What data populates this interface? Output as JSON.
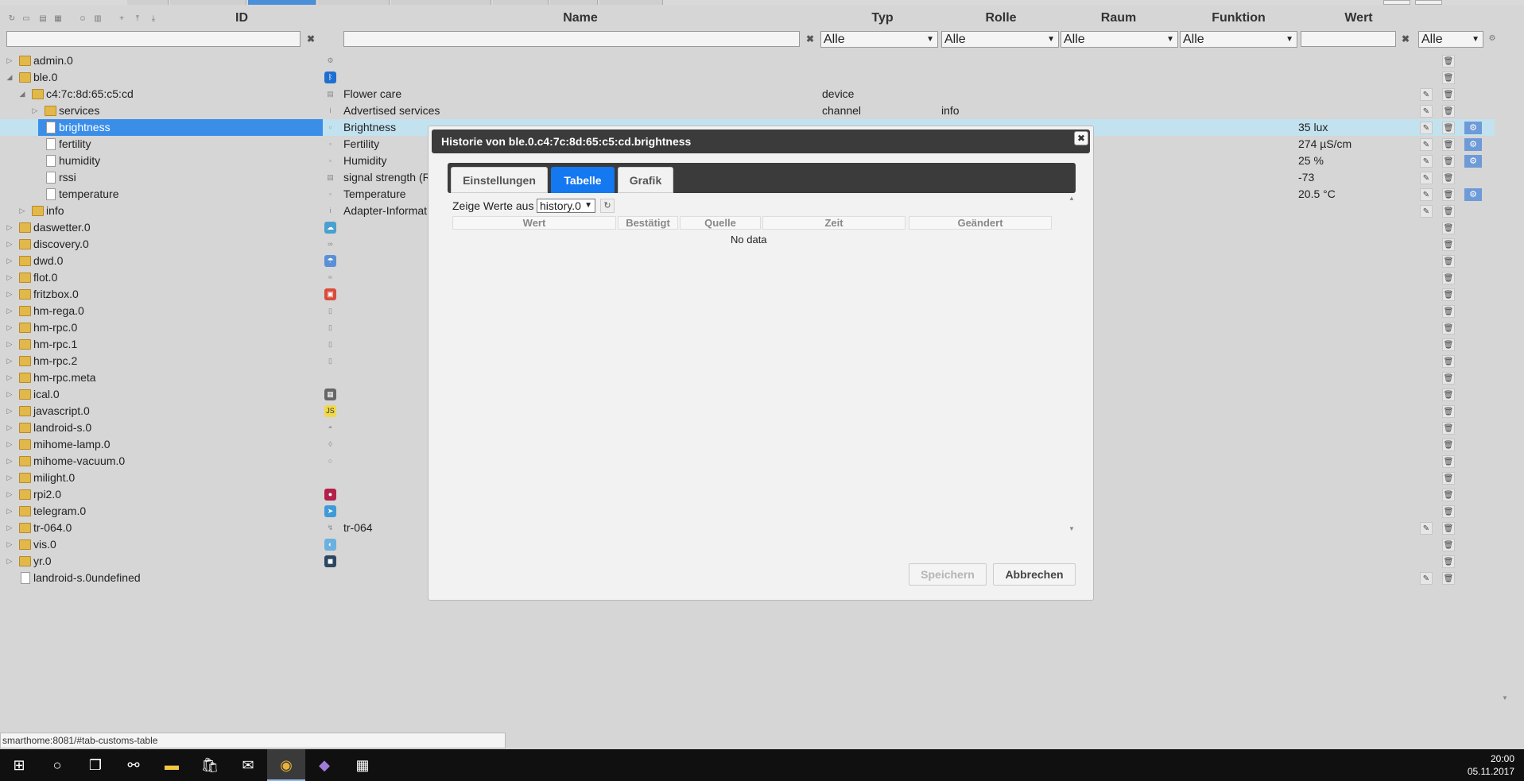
{
  "header": {
    "columns": {
      "id": "ID",
      "name": "Name",
      "typ": "Typ",
      "rolle": "Rolle",
      "raum": "Raum",
      "funktion": "Funktion",
      "wert": "Wert"
    },
    "filters": {
      "typ": "Alle",
      "rolle": "Alle",
      "raum": "Alle",
      "funktion": "Alle",
      "extra": "Alle"
    },
    "clear_glyph": "✖",
    "toolbar_icons": [
      "refresh-icon",
      "collapse-icon",
      "folder-icon",
      "folder-open-icon",
      "user-icon",
      "list-icon",
      "add-icon",
      "upload-icon",
      "download-icon"
    ]
  },
  "tree": {
    "rows": [
      {
        "id": "admin.0",
        "name": "",
        "typ": "",
        "rolle": "",
        "wert": "",
        "icon": "gear-icon",
        "kind": "folder",
        "level": 0
      },
      {
        "id": "ble.0",
        "name": "",
        "typ": "",
        "rolle": "",
        "wert": "",
        "icon": "bluetooth-icon",
        "kind": "folder",
        "level": 0,
        "expanded": true
      },
      {
        "id": "c4:7c:8d:65:c5:cd",
        "name": "Flower care",
        "typ": "device",
        "rolle": "",
        "wert": "",
        "icon": "device-icon",
        "kind": "folder",
        "level": 1,
        "expanded": true
      },
      {
        "id": "services",
        "name": "Advertised services",
        "typ": "channel",
        "rolle": "info",
        "wert": "",
        "icon": "info-icon",
        "kind": "folder",
        "level": 2
      },
      {
        "id": "brightness",
        "name": "Brightness",
        "typ": "",
        "rolle": "",
        "wert": "35 lux",
        "icon": "state-icon",
        "kind": "file",
        "level": 2,
        "selected": true
      },
      {
        "id": "fertility",
        "name": "Fertility",
        "typ": "",
        "rolle": "",
        "wert": "274 µS/cm",
        "icon": "state-icon",
        "kind": "file",
        "level": 2
      },
      {
        "id": "humidity",
        "name": "Humidity",
        "typ": "",
        "rolle": "",
        "wert": "25 %",
        "icon": "state-icon",
        "kind": "file",
        "level": 2
      },
      {
        "id": "rssi",
        "name": "signal strength (R",
        "typ": "",
        "rolle": "",
        "wert": "-73",
        "icon": "signal-icon",
        "kind": "file",
        "level": 2
      },
      {
        "id": "temperature",
        "name": "Temperature",
        "typ": "",
        "rolle": "",
        "wert": "20.5 °C",
        "icon": "state-icon",
        "kind": "file",
        "level": 2
      },
      {
        "id": "info",
        "name": "Adapter-Informat",
        "typ": "",
        "rolle": "",
        "wert": "",
        "icon": "info-icon",
        "kind": "folder",
        "level": 1
      },
      {
        "id": "daswetter.0",
        "name": "",
        "typ": "",
        "rolle": "",
        "wert": "",
        "icon": "weather-icon",
        "kind": "folder",
        "level": 0
      },
      {
        "id": "discovery.0",
        "name": "",
        "typ": "",
        "rolle": "",
        "wert": "",
        "icon": "binoculars-icon",
        "kind": "folder",
        "level": 0
      },
      {
        "id": "dwd.0",
        "name": "",
        "typ": "",
        "rolle": "",
        "wert": "",
        "icon": "dwd-icon",
        "kind": "folder",
        "level": 0
      },
      {
        "id": "flot.0",
        "name": "",
        "typ": "",
        "rolle": "",
        "wert": "",
        "icon": "flot-icon",
        "kind": "folder",
        "level": 0
      },
      {
        "id": "fritzbox.0",
        "name": "",
        "typ": "",
        "rolle": "",
        "wert": "",
        "icon": "fritzbox-icon",
        "kind": "folder",
        "level": 0
      },
      {
        "id": "hm-rega.0",
        "name": "",
        "typ": "",
        "rolle": "",
        "wert": "",
        "icon": "homematic-icon",
        "kind": "folder",
        "level": 0
      },
      {
        "id": "hm-rpc.0",
        "name": "",
        "typ": "",
        "rolle": "",
        "wert": "",
        "icon": "homematic-icon",
        "kind": "folder",
        "level": 0
      },
      {
        "id": "hm-rpc.1",
        "name": "",
        "typ": "",
        "rolle": "",
        "wert": "",
        "icon": "homematic-icon",
        "kind": "folder",
        "level": 0
      },
      {
        "id": "hm-rpc.2",
        "name": "",
        "typ": "",
        "rolle": "",
        "wert": "",
        "icon": "homematic-icon",
        "kind": "folder",
        "level": 0
      },
      {
        "id": "hm-rpc.meta",
        "name": "",
        "typ": "",
        "rolle": "",
        "wert": "",
        "icon": "",
        "kind": "folder",
        "level": 0
      },
      {
        "id": "ical.0",
        "name": "",
        "typ": "",
        "rolle": "",
        "wert": "",
        "icon": "calendar-icon",
        "kind": "folder",
        "level": 0
      },
      {
        "id": "javascript.0",
        "name": "",
        "typ": "",
        "rolle": "",
        "wert": "",
        "icon": "javascript-icon",
        "kind": "folder",
        "level": 0
      },
      {
        "id": "landroid-s.0",
        "name": "",
        "typ": "",
        "rolle": "",
        "wert": "",
        "icon": "mower-icon",
        "kind": "folder",
        "level": 0
      },
      {
        "id": "mihome-lamp.0",
        "name": "",
        "typ": "",
        "rolle": "",
        "wert": "",
        "icon": "lamp-icon",
        "kind": "folder",
        "level": 0
      },
      {
        "id": "mihome-vacuum.0",
        "name": "",
        "typ": "",
        "rolle": "",
        "wert": "",
        "icon": "vacuum-icon",
        "kind": "folder",
        "level": 0
      },
      {
        "id": "milight.0",
        "name": "",
        "typ": "",
        "rolle": "",
        "wert": "",
        "icon": "",
        "kind": "folder",
        "level": 0
      },
      {
        "id": "rpi2.0",
        "name": "",
        "typ": "",
        "rolle": "",
        "wert": "",
        "icon": "raspberry-icon",
        "kind": "folder",
        "level": 0
      },
      {
        "id": "telegram.0",
        "name": "",
        "typ": "",
        "rolle": "",
        "wert": "",
        "icon": "telegram-icon",
        "kind": "folder",
        "level": 0
      },
      {
        "id": "tr-064.0",
        "name": "tr-064",
        "typ": "",
        "rolle": "",
        "wert": "",
        "icon": "tr064-icon",
        "kind": "folder",
        "level": 0
      },
      {
        "id": "vis.0",
        "name": "",
        "typ": "",
        "rolle": "",
        "wert": "",
        "icon": "vis-icon",
        "kind": "folder",
        "level": 0
      },
      {
        "id": "yr.0",
        "name": "",
        "typ": "",
        "rolle": "",
        "wert": "",
        "icon": "yr-icon",
        "kind": "folder",
        "level": 0
      },
      {
        "id": "landroid-s.0undefined",
        "name": "",
        "typ": "",
        "rolle": "",
        "wert": "",
        "icon": "",
        "kind": "file",
        "level": 0
      }
    ]
  },
  "dialog": {
    "title": "Historie von ble.0.c4:7c:8d:65:c5:cd.brightness",
    "close": "✖",
    "tabs": [
      {
        "label": "Einstellungen",
        "active": false
      },
      {
        "label": "Tabelle",
        "active": true
      },
      {
        "label": "Grafik",
        "active": false
      }
    ],
    "source_label": "Zeige Werte aus",
    "source_value": "history.0",
    "refresh": "↻",
    "columns": [
      "Wert",
      "Bestätigt",
      "Quelle",
      "Zeit",
      "Geändert"
    ],
    "empty": "No data",
    "save": "Speichern",
    "cancel": "Abbrechen"
  },
  "status_url": "smarthome:8081/#tab-customs-table",
  "taskbar": {
    "apps": [
      "windows-start-icon",
      "cortana-icon",
      "task-view-icon",
      "network-app-icon",
      "file-explorer-icon",
      "store-icon",
      "mail-icon",
      "chrome-icon",
      "visual-studio-icon",
      "calculator-icon"
    ],
    "active_app": "chrome-icon",
    "time": "20:00",
    "date": "05.11.2017"
  }
}
